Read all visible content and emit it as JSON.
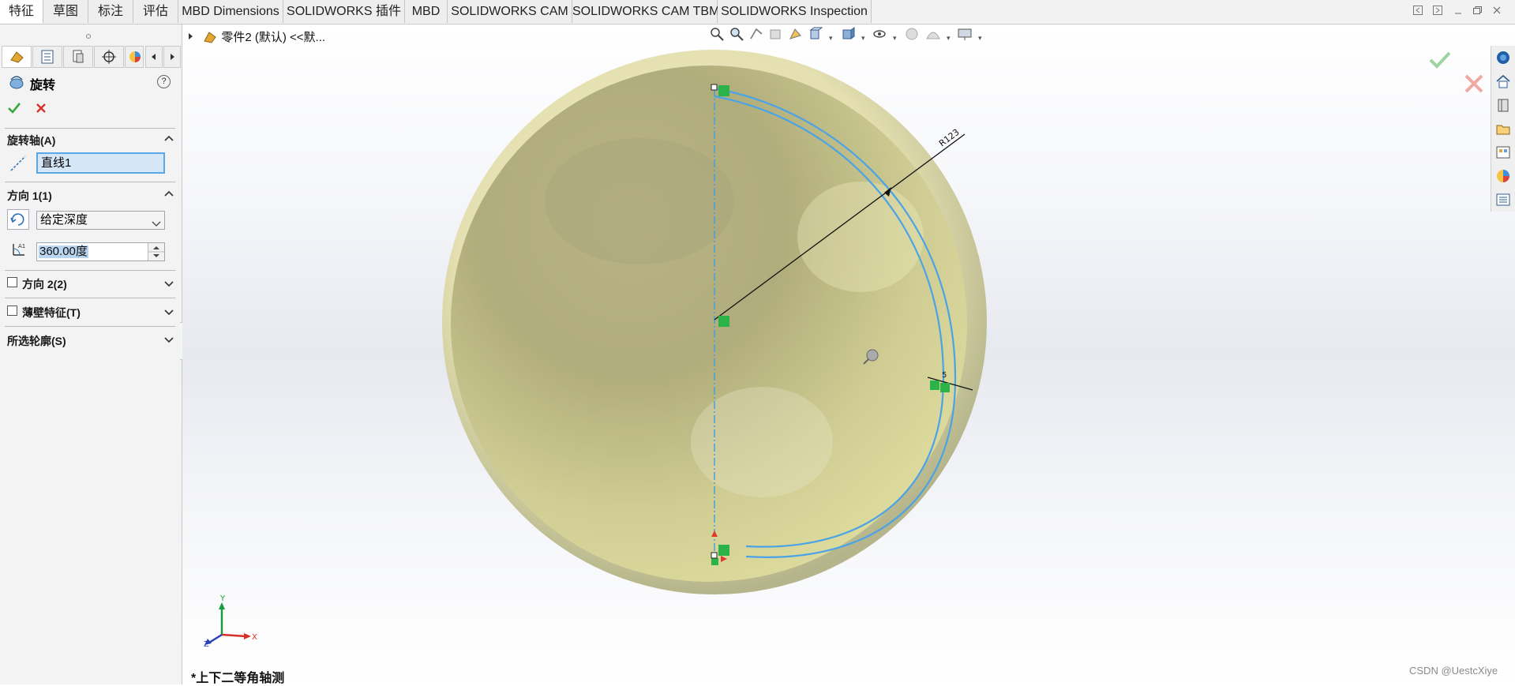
{
  "tabs": [
    "特征",
    "草图",
    "标注",
    "评估",
    "MBD Dimensions",
    "SOLIDWORKS 插件",
    "MBD",
    "SOLIDWORKS CAM",
    "SOLIDWORKS CAM TBM",
    "SOLIDWORKS Inspection"
  ],
  "feature_tree": {
    "item": "零件2 (默认) <<默..."
  },
  "property_manager": {
    "title": "旋转",
    "help": "?",
    "axis_section": {
      "label": "旋转轴(A)",
      "value": "直线1"
    },
    "direction1": {
      "label": "方向 1(1)",
      "end_condition": "给定深度",
      "angle": "360.00度"
    },
    "direction2": {
      "label": "方向 2(2)"
    },
    "thin_feature": {
      "label": "薄壁特征(T)"
    },
    "selected_contours": {
      "label": "所选轮廓(S)"
    }
  },
  "sketch": {
    "dimension_label": "R123",
    "small_dim": "5"
  },
  "triad": {
    "x": "X",
    "y": "Y",
    "z": "Z"
  },
  "view_name": "*上下二等角轴测",
  "watermark": "CSDN @UestcXiye",
  "colors": {
    "accent_blue": "#3d9ee0",
    "sphere": "#c9c88c",
    "confirm_green": "#3aa53a",
    "cancel_red": "#d9312b"
  }
}
